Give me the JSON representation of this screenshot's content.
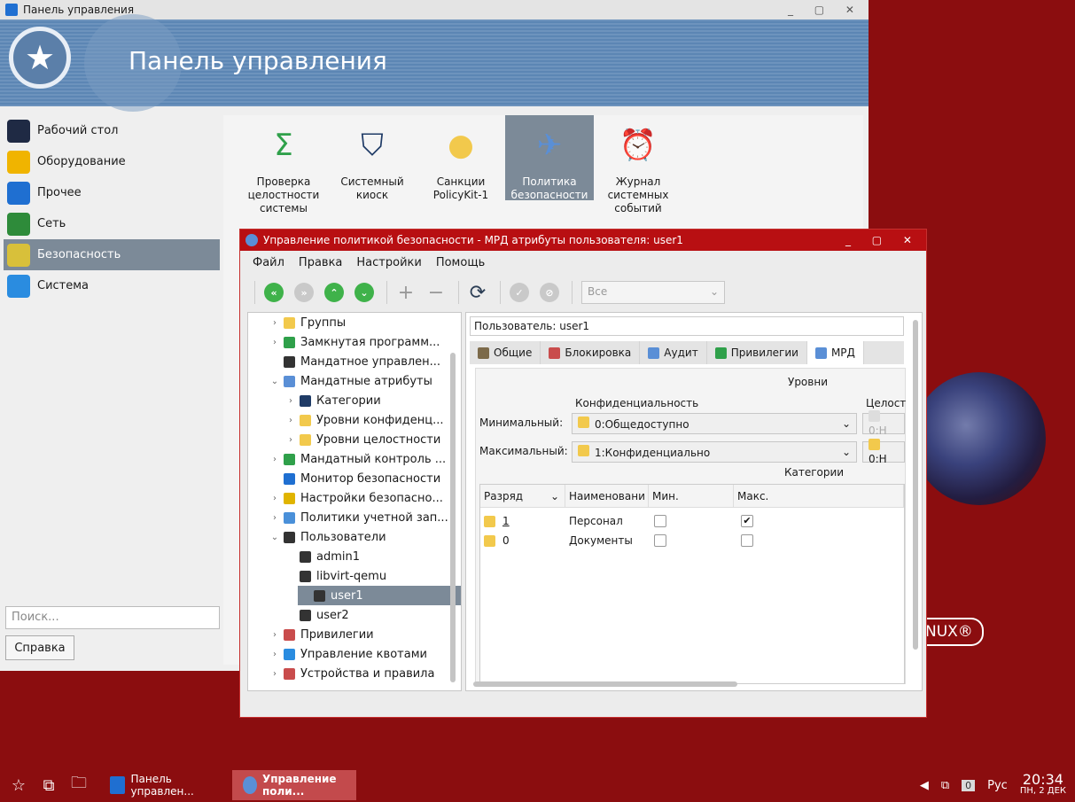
{
  "control_panel": {
    "window_title": "Панель управления",
    "banner_title": "Панель управления",
    "sidebar": [
      {
        "label": "Рабочий стол",
        "icon": "desktop-icon",
        "color": "#1f2a44"
      },
      {
        "label": "Оборудование",
        "icon": "hardware-icon",
        "color": "#f0b400"
      },
      {
        "label": "Прочее",
        "icon": "misc-icon",
        "color": "#1f6fd1"
      },
      {
        "label": "Сеть",
        "icon": "network-icon",
        "color": "#2e8b3a"
      },
      {
        "label": "Безопасность",
        "icon": "security-icon",
        "color": "#d8c03a",
        "active": true
      },
      {
        "label": "Система",
        "icon": "system-icon",
        "color": "#2a8ce0"
      }
    ],
    "search_placeholder": "Поиск...",
    "help_label": "Справка",
    "apps": [
      {
        "label": "Проверка целостности системы",
        "icon": "sigma-lock-icon"
      },
      {
        "label": "Системный киоск",
        "icon": "kiosk-icon"
      },
      {
        "label": "Санкции PolicyKit-1",
        "icon": "policykit-icon"
      },
      {
        "label": "Политика безопасности",
        "icon": "security-policy-icon",
        "active": true
      },
      {
        "label": "Журнал системных событий",
        "icon": "event-log-icon"
      }
    ]
  },
  "dialog": {
    "title": "Управление политикой безопасности - МРД атрибуты пользователя: user1",
    "menu": [
      "Файл",
      "Правка",
      "Настройки",
      "Помощь"
    ],
    "filter_value": "Все",
    "tree": [
      {
        "label": "Группы",
        "arrow": "›",
        "indent": 1
      },
      {
        "label": "Замкнутая программ...",
        "arrow": "›",
        "indent": 1
      },
      {
        "label": "Мандатное управлен...",
        "arrow": "",
        "indent": 1
      },
      {
        "label": "Мандатные атрибуты",
        "arrow": "⌄",
        "indent": 1
      },
      {
        "label": "Категории",
        "arrow": "›",
        "indent": 2
      },
      {
        "label": "Уровни конфиденц...",
        "arrow": "›",
        "indent": 2
      },
      {
        "label": "Уровни целостности",
        "arrow": "›",
        "indent": 2
      },
      {
        "label": "Мандатный контроль ...",
        "arrow": "›",
        "indent": 1
      },
      {
        "label": "Монитор безопасности",
        "arrow": "",
        "indent": 1
      },
      {
        "label": "Настройки безопасно...",
        "arrow": "›",
        "indent": 1
      },
      {
        "label": "Политики учетной зап...",
        "arrow": "›",
        "indent": 1
      },
      {
        "label": "Пользователи",
        "arrow": "⌄",
        "indent": 1
      },
      {
        "label": "admin1",
        "arrow": "",
        "indent": 2
      },
      {
        "label": "libvirt-qemu",
        "arrow": "",
        "indent": 2
      },
      {
        "label": "user1",
        "arrow": "",
        "indent": 2,
        "selected": true
      },
      {
        "label": "user2",
        "arrow": "",
        "indent": 2
      },
      {
        "label": "Привилегии",
        "arrow": "›",
        "indent": 1
      },
      {
        "label": "Управление квотами",
        "arrow": "›",
        "indent": 1
      },
      {
        "label": "Устройства и правила",
        "arrow": "›",
        "indent": 1
      }
    ],
    "user_label": "Пользователь: user1",
    "tabs": [
      "Общие",
      "Блокировка",
      "Аудит",
      "Привилегии",
      "МРД"
    ],
    "active_tab": "МРД",
    "levels_header": "Уровни",
    "conf_header": "Конфиденциальность",
    "integrity_header": "Целост",
    "min_label": "Минимальный:",
    "max_label": "Максимальный:",
    "min_conf": "0:Общедоступно",
    "max_conf": "1:Конфиденциально",
    "min_integrity": "0:Н",
    "max_integrity": "0:Н",
    "categories_header": "Категории",
    "columns": [
      "Разряд",
      "Наименовани",
      "Мин.",
      "Макс."
    ],
    "rows": [
      {
        "bit": "1",
        "name": "Персонал",
        "min": false,
        "max": true
      },
      {
        "bit": "0",
        "name": "Документы",
        "min": false,
        "max": false
      }
    ]
  },
  "taskbar": {
    "tasks": [
      "Панель управлен...",
      "Управление поли..."
    ],
    "keyboard_layout": "Рус",
    "notifications": "0",
    "time": "20:34",
    "date": "ПН, 2 ДЕК"
  },
  "desktop_logo": "NUX®"
}
